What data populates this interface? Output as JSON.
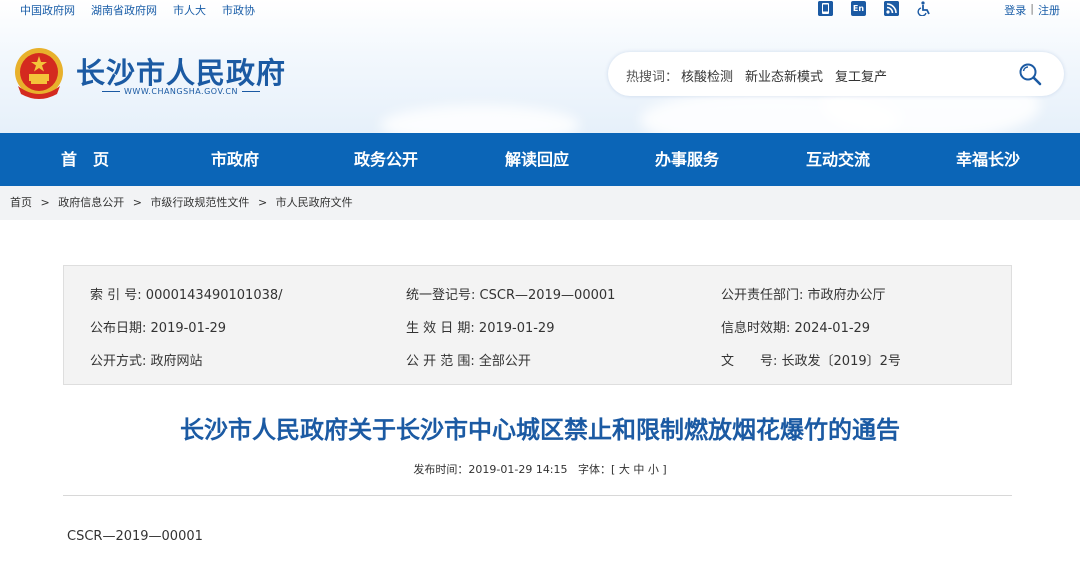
{
  "topbar": {
    "links": [
      "中国政府网",
      "湖南省政府网",
      "市人大",
      "市政协"
    ],
    "icons": [
      "mobile-icon",
      "english-icon",
      "rss-icon",
      "accessibility-icon"
    ],
    "english_label": "En",
    "login": "登录",
    "separator": "|",
    "register": "注册"
  },
  "site": {
    "title": "长沙市人民政府",
    "url": "WWW.CHANGSHA.GOV.CN"
  },
  "search": {
    "hot_label": "热搜词：",
    "hot_items": [
      "核酸检测",
      "新业态新模式",
      "复工复产"
    ]
  },
  "nav": {
    "items": [
      "首　页",
      "市政府",
      "政务公开",
      "解读回应",
      "办事服务",
      "互动交流",
      "幸福长沙"
    ]
  },
  "breadcrumb": {
    "items": [
      "首页",
      "政府信息公开",
      "市级行政规范性文件",
      "市人民政府文件"
    ],
    "separator": ">"
  },
  "info": {
    "index_label": "索 引 号:",
    "index_value": "0000143490101038/",
    "reg_label": "统一登记号:",
    "reg_value": "CSCR—2019—00001",
    "dept_label": "公开责任部门:",
    "dept_value": "市政府办公厅",
    "pubdate_label": "公布日期:",
    "pubdate_value": "2019-01-29",
    "effdate_label": "生 效 日 期:",
    "effdate_value": "2019-01-29",
    "expire_label": "信息时效期:",
    "expire_value": "2024-01-29",
    "method_label": "公开方式:",
    "method_value": "政府网站",
    "scope_label": "公 开 范 围:",
    "scope_value": "全部公开",
    "docno_label": "文　　号:",
    "docno_value": "长政发〔2019〕2号"
  },
  "article": {
    "title": "长沙市人民政府关于长沙市中心城区禁止和限制燃放烟花爆竹的通告",
    "pubtime_label": "发布时间：",
    "pubtime_value": "2019-01-29 14:15",
    "font_label": "字体：",
    "font_open": "[",
    "font_large": "大",
    "font_medium": "中",
    "font_small": "小",
    "font_close": "]",
    "doc_number": "CSCR—2019—00001"
  },
  "colors": {
    "brand": "#1b5aa3",
    "nav": "#0b65b7"
  }
}
